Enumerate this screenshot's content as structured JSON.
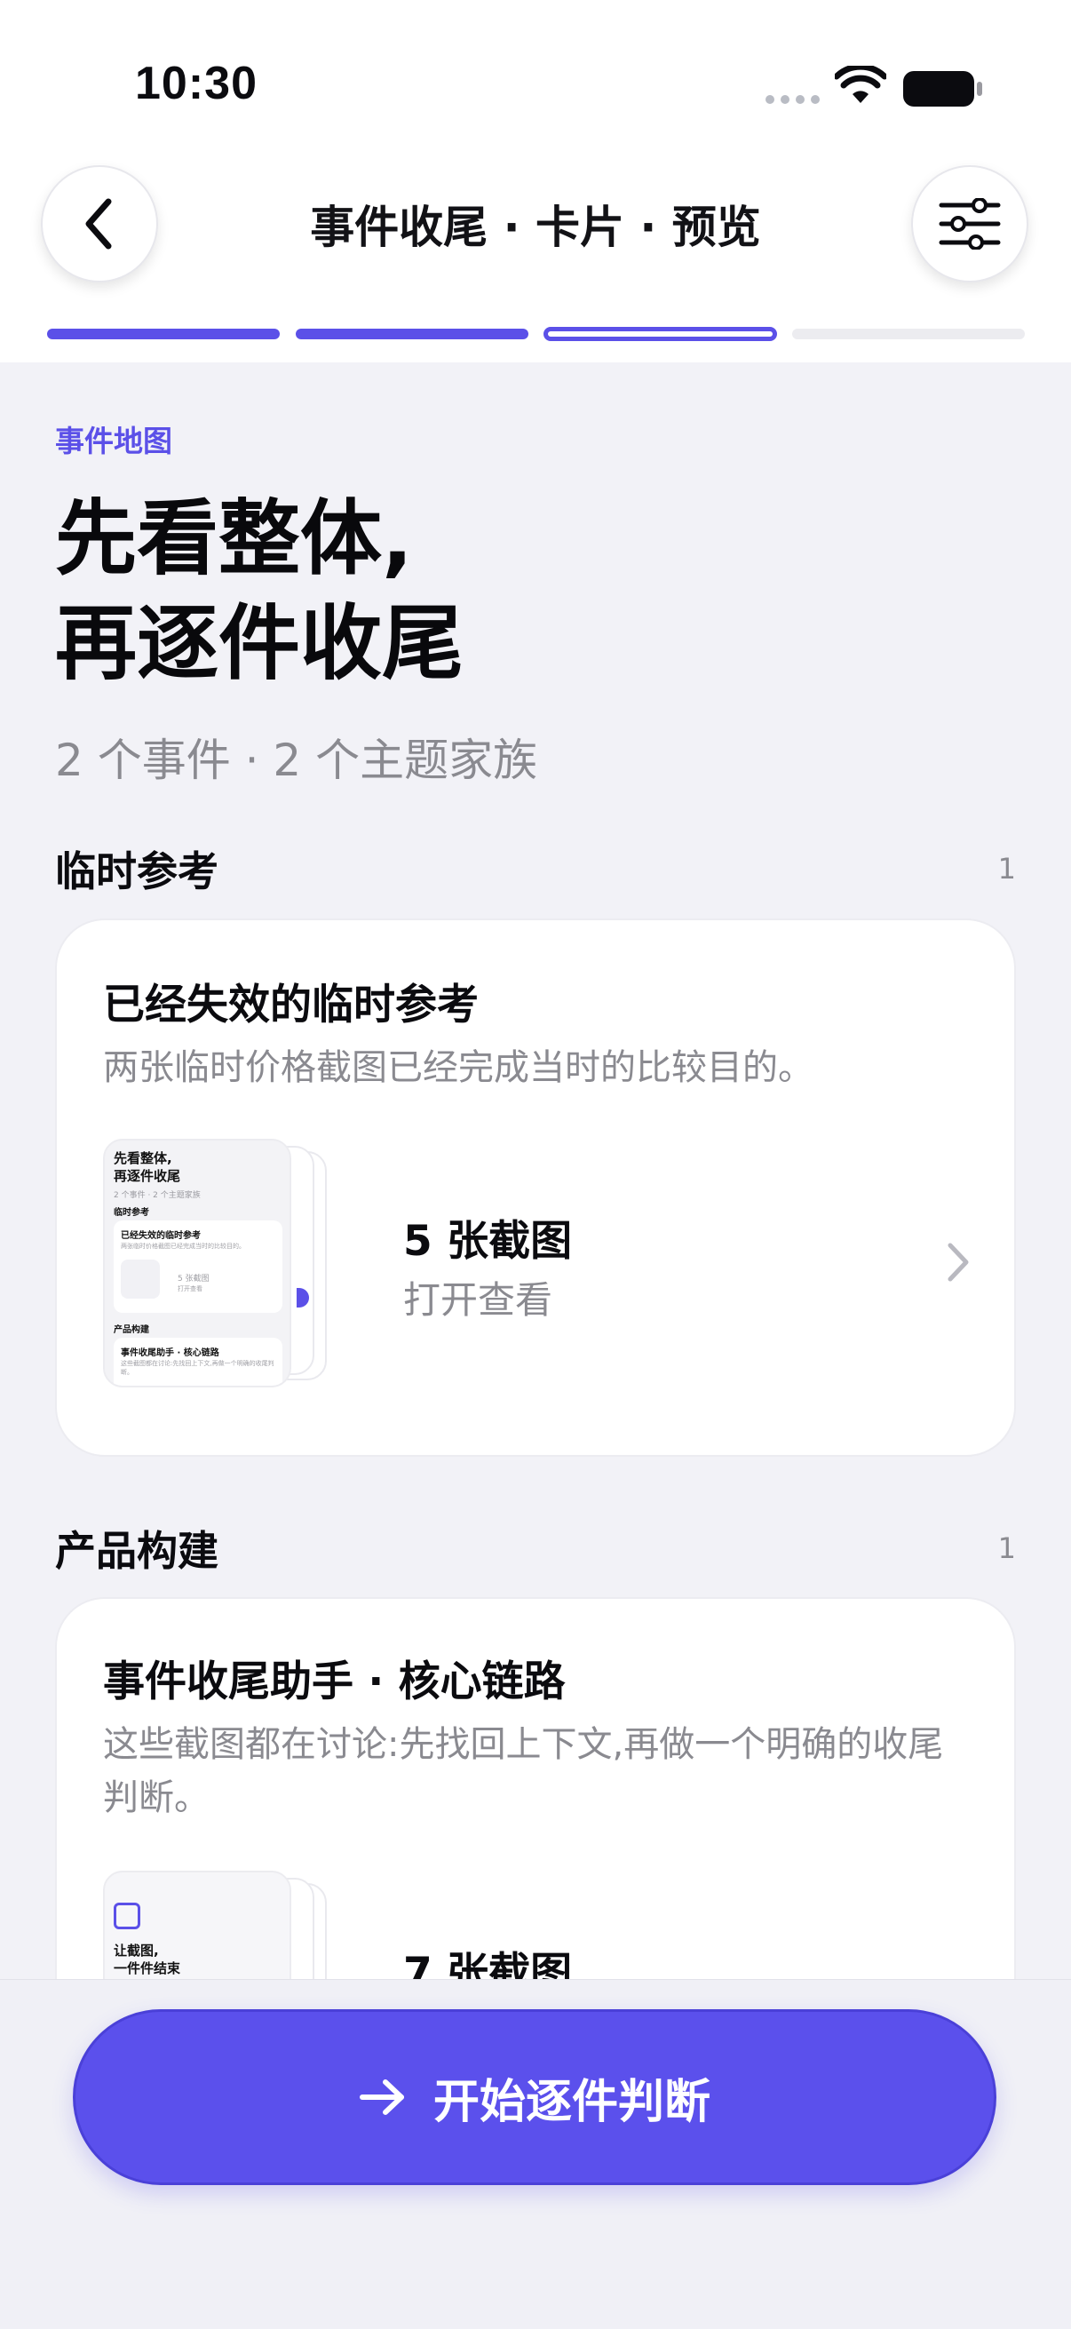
{
  "status": {
    "time": "10:30"
  },
  "nav": {
    "title": "事件收尾 · 卡片 · 预览"
  },
  "hero": {
    "eyebrow": "事件地图",
    "headline_line1": "先看整体,",
    "headline_line2": "再逐件收尾",
    "subline": "2 个事件 · 2 个主题家族"
  },
  "sections": [
    {
      "title": "临时参考",
      "count": "1",
      "card": {
        "title": "已经失效的临时参考",
        "description": "两张临时价格截图已经完成当时的比较目的。",
        "screenshot_count": "5 张截图",
        "action": "打开查看",
        "thumb": {
          "h1": "先看整体,",
          "h2": "再逐件收尾",
          "sub": "2 个事件 · 2 个主题家族",
          "sec1": "临时参考",
          "c1_title": "已经失效的临时参考",
          "c1_desc": "两张临时价格截图已经完成当时的比较目的。",
          "c1_count": "5 张截图",
          "c1_action": "打开查看",
          "sec2": "产品构建",
          "c2_title": "事件收尾助手 · 核心链路",
          "c2_desc": "这些截图都在讨论:先找回上下文,再做一个明确的收尾判断。"
        }
      }
    },
    {
      "title": "产品构建",
      "count": "1",
      "card": {
        "title": "事件收尾助手 · 核心链路",
        "description": "这些截图都在讨论:先找回上下文,再做一个明确的收尾判断。",
        "screenshot_count": "7 张截图",
        "thumb": {
          "h1": "让截图,",
          "h2": "一件件结束"
        }
      }
    }
  ],
  "cta": {
    "label": "开始逐件判断"
  },
  "colors": {
    "accent": "#5b50e8",
    "background": "#f2f2f7",
    "muted": "#8a8a90"
  },
  "icons": [
    "chevron-left-icon",
    "sliders-icon",
    "chevron-right-icon",
    "arrow-right-icon",
    "wifi-icon",
    "battery-icon"
  ]
}
